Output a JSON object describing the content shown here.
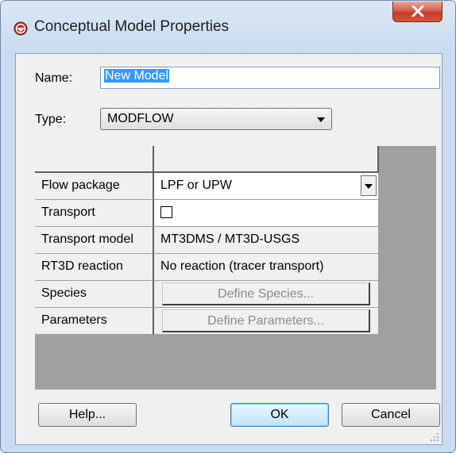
{
  "window": {
    "title": "Conceptual Model Properties",
    "icons": {
      "app": "model-icon",
      "close": "close-icon"
    }
  },
  "form": {
    "name_label": "Name:",
    "name_value": "New Model",
    "type_label": "Type:",
    "type_value": "MODFLOW"
  },
  "grid": {
    "rows": [
      {
        "label": "Flow package",
        "value": "LPF or UPW",
        "kind": "combo"
      },
      {
        "label": "Transport",
        "value": "",
        "kind": "checkbox",
        "checked": false
      },
      {
        "label": "Transport model",
        "value": "MT3DMS / MT3D-USGS",
        "kind": "text"
      },
      {
        "label": "RT3D reaction",
        "value": "No reaction (tracer transport)",
        "kind": "text"
      },
      {
        "label": "Species",
        "value": "Define Species...",
        "kind": "button",
        "enabled": false
      },
      {
        "label": "Parameters",
        "value": "Define Parameters...",
        "kind": "button",
        "enabled": false
      }
    ]
  },
  "buttons": {
    "help": "Help...",
    "ok": "OK",
    "cancel": "Cancel"
  },
  "colors": {
    "selection": "#3399ff",
    "grid_background": "#a0a0a0",
    "close_button": "#c8432b"
  }
}
